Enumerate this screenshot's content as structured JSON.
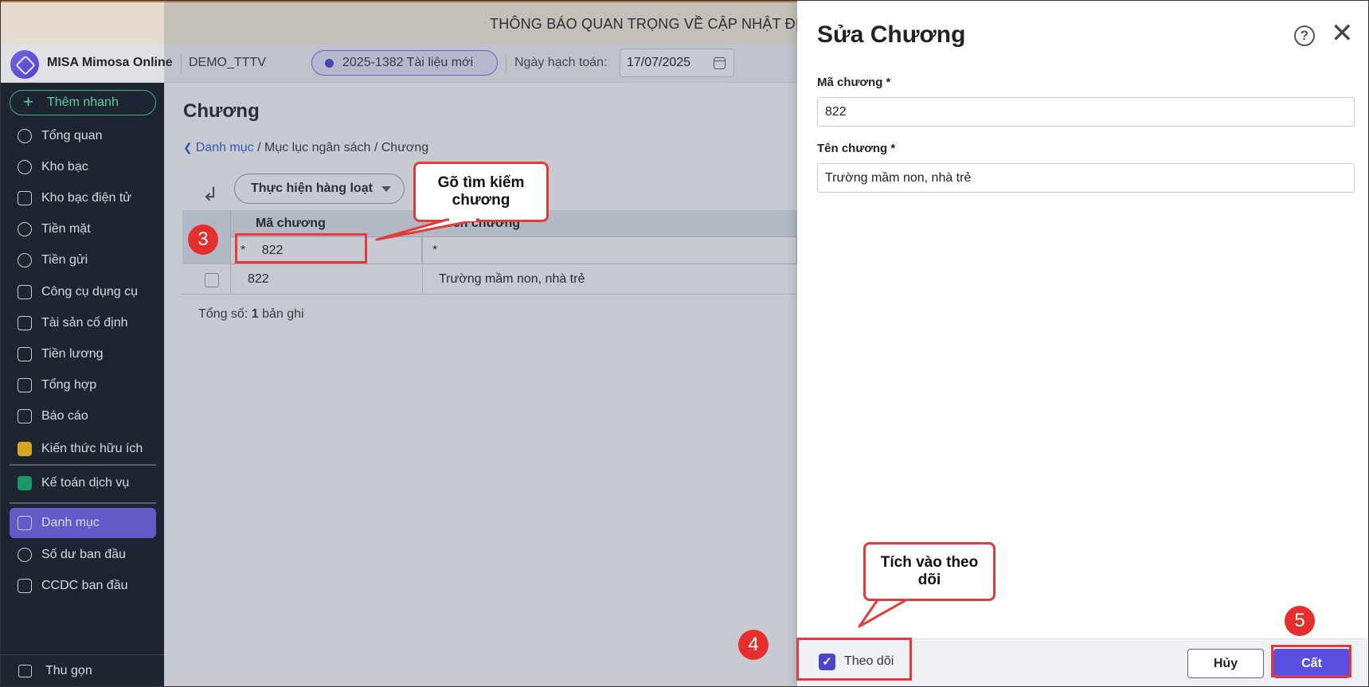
{
  "banner": {
    "text": "THÔNG BÁO QUAN TRỌNG VỀ CẬP NHẬT ĐỊA CHỈ THEO ĐỊA BÀN HÀ"
  },
  "header": {
    "brand": "MISA Mimosa Online",
    "database": "DEMO_TTTV",
    "document_pill": "2025-1382 Tài liệu mới",
    "date_label": "Ngày hạch toán:",
    "date_value": "17/07/2025"
  },
  "sidebar": {
    "quick_add": "Thêm nhanh",
    "items": [
      {
        "label": "Tổng quan",
        "icon": "chart-pie-icon"
      },
      {
        "label": "Kho bạc",
        "icon": "treasury-icon"
      },
      {
        "label": "Kho bạc điện tử",
        "icon": "e-treasury-icon"
      },
      {
        "label": "Tiền mặt",
        "icon": "cash-icon"
      },
      {
        "label": "Tiền gửi",
        "icon": "deposit-icon"
      },
      {
        "label": "Công cụ dụng cụ",
        "icon": "tools-icon"
      },
      {
        "label": "Tài sản cố định",
        "icon": "truck-icon"
      },
      {
        "label": "Tiền lương",
        "icon": "salary-icon"
      },
      {
        "label": "Tổng hợp",
        "icon": "summary-icon"
      },
      {
        "label": "Báo cáo",
        "icon": "report-icon"
      }
    ],
    "extras": [
      {
        "label": "Kiến thức hữu ích",
        "icon": "knowledge-icon"
      },
      {
        "label": "Kế toán dịch vụ",
        "icon": "accounting-service-icon"
      }
    ],
    "lower": [
      {
        "label": "Danh mục",
        "icon": "catalog-icon"
      },
      {
        "label": "Số dư ban đầu",
        "icon": "opening-balance-icon"
      },
      {
        "label": "CCDC ban đầu",
        "icon": "initial-tools-icon"
      }
    ],
    "collapse": "Thu gọn"
  },
  "main": {
    "title": "Chương",
    "breadcrumb": {
      "link": "Danh mục",
      "rest": " / Mục lục ngân sách / Chương"
    },
    "batch_button": "Thực hiện hàng loạt",
    "columns": [
      "Mã chương",
      "Tên chương"
    ],
    "filter": {
      "code": "822",
      "name": ""
    },
    "rows": [
      {
        "code": "822",
        "name": "Trường mầm non, nhà trẻ"
      }
    ],
    "total_prefix": "Tổng số:",
    "total_count": "1",
    "total_suffix": "bản ghi"
  },
  "panel": {
    "title": "Sửa Chương",
    "code_label": "Mã chương *",
    "code_value": "822",
    "name_label": "Tên chương *",
    "name_value": "Trường mầm non, nhà trẻ",
    "follow_label": "Theo dõi",
    "cancel": "Hủy",
    "save": "Cất"
  },
  "annotations": {
    "callout_search": "Gõ tìm kiếm chương",
    "callout_follow": "Tích vào theo dõi",
    "steps": [
      "3",
      "4",
      "5"
    ]
  },
  "colors": {
    "accent": "#5a4fe0",
    "annotation_red": "#e33a3a",
    "sidebar_bg": "#1c2433"
  }
}
